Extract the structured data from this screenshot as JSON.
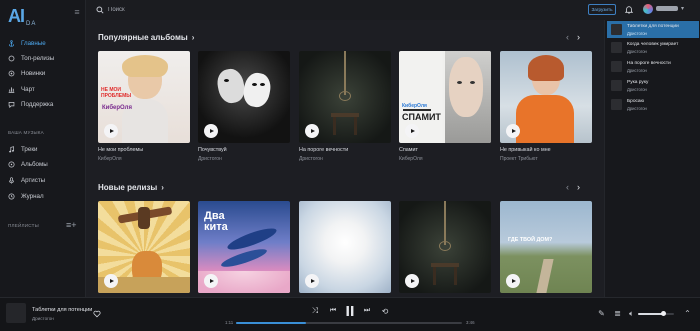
{
  "app": {
    "logo_main": "AI",
    "logo_sub": "DA"
  },
  "sidebar": {
    "main_items": [
      {
        "label": "Главные",
        "icon": "anchor-icon",
        "active": true
      },
      {
        "label": "Топ-релизы",
        "icon": "circle-icon",
        "active": false
      },
      {
        "label": "Новинки",
        "icon": "circle-icon",
        "active": false
      },
      {
        "label": "Чарт",
        "icon": "chart-icon",
        "active": false
      },
      {
        "label": "Поддержка",
        "icon": "chat-icon",
        "active": false
      }
    ],
    "music_section_label": "ВАША МУЗЫКА",
    "music_items": [
      {
        "label": "Треки",
        "icon": "music-note-icon"
      },
      {
        "label": "Альбомы",
        "icon": "disc-icon"
      },
      {
        "label": "Артисты",
        "icon": "mic-icon"
      },
      {
        "label": "Журнал",
        "icon": "history-icon"
      }
    ],
    "playlists_label": "ПЛЕЙЛИСТЫ"
  },
  "topbar": {
    "search_placeholder": "Поиск",
    "upload_label": "Загрузить"
  },
  "popular": {
    "title": "Популярные альбомы",
    "cards": [
      {
        "title": "Не мои проблемы",
        "artist": "КиберОля",
        "cover_text": "НЕ МОИ ПРОБЛЕМЫ",
        "cover_sub": "КиберОля"
      },
      {
        "title": "Почувствуй",
        "artist": "Дристогон"
      },
      {
        "title": "На пороге вечности",
        "artist": "Дристогон"
      },
      {
        "title": "Спамит",
        "artist": "КиберОля",
        "cover_text": "СПАМИТ",
        "cover_sub": "КиберОля"
      },
      {
        "title": "Не привыкай ко мне",
        "artist": "Проект Трибьют"
      }
    ]
  },
  "new_releases": {
    "title": "Новые релизы",
    "cards": [
      {
        "cover_text": ""
      },
      {
        "cover_text": "Два кита"
      },
      {
        "cover_text": ""
      },
      {
        "cover_text": ""
      },
      {
        "cover_text": "ГДЕ ТВОЙ ДОМ?"
      }
    ]
  },
  "queue": [
    {
      "title": "Таблетки для потенции",
      "artist": "Дристогон",
      "active": true
    },
    {
      "title": "Когда человек умирает",
      "artist": "Дристогон",
      "active": false
    },
    {
      "title": "На пороге вечности",
      "artist": "Дристогон",
      "active": false
    },
    {
      "title": "Рука руку",
      "artist": "Дристогон",
      "active": false
    },
    {
      "title": "Бросаю",
      "artist": "Дристогон",
      "active": false
    }
  ],
  "player": {
    "title": "Таблетки для потенции",
    "artist": "Дристогон",
    "elapsed": "1:11",
    "duration": "3:46",
    "progress": 0.31,
    "volume": 0.72
  },
  "colors": {
    "accent": "#2a6fa8",
    "link": "#4da8ee"
  }
}
